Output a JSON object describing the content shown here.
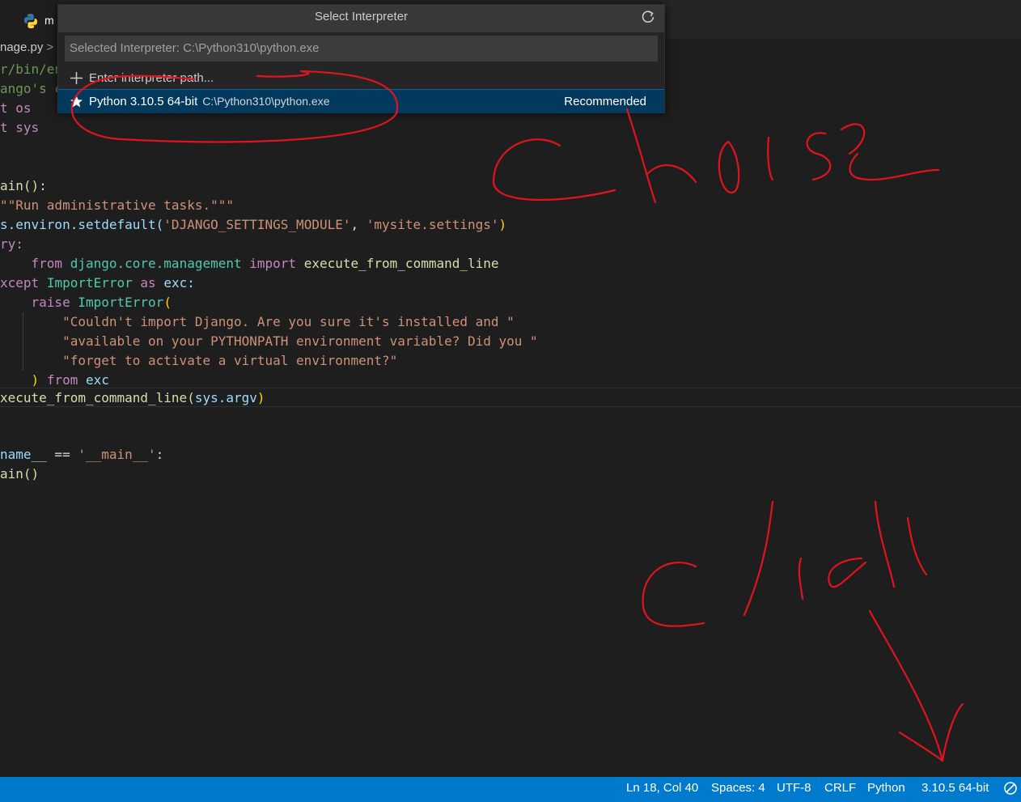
{
  "tab": {
    "label": "m"
  },
  "breadcrumb": {
    "file": "nage.py",
    "separator": ">"
  },
  "code_lines": [
    "r/bin/en",
    "ango's c",
    "t os",
    "t sys"
  ],
  "quick_pick": {
    "title": "Select Interpreter",
    "input_placeholder": "Selected Interpreter: C:\\Python310\\python.exe",
    "items": [
      {
        "label": "Enter interpreter path...",
        "description": "",
        "badge": "",
        "icon": "plus-icon"
      },
      {
        "label": "Python 3.10.5 64-bit",
        "description": "C:\\Python310\\python.exe",
        "badge": "Recommended",
        "icon": "star-icon"
      }
    ]
  },
  "editor": {
    "code": {
      "main_def": "ain():",
      "docstring": "\"\"Run administrative tasks.\"\"\"",
      "environ": "s.environ.setdefault(",
      "settings_key": "'DJANGO_SETTINGS_MODULE'",
      "comma": ", ",
      "settings_val": "'mysite.settings'",
      "try": "ry:",
      "from": "from",
      "module": "django.core.management",
      "import": "import",
      "exec_name": "execute_from_command_line",
      "except": "xcept",
      "import_error": "ImportError",
      "as": "as",
      "exc": "exc:",
      "raise": "raise",
      "err_str1": "\"Couldn't import Django. Are you sure it's installed and \"",
      "err_str2": "\"available on your PYTHONPATH environment variable? Did you \"",
      "err_str3": "\"forget to activate a virtual environment?\"",
      "from_exc": "from",
      "exc_name": "exc",
      "exec_call": "xecute_from_command_line(",
      "argv": "sys.argv",
      "name": "name__",
      "eq": " == ",
      "main_str": "'__main__'",
      "colon": ":",
      "main_call": "ain()"
    }
  },
  "annotations": {
    "choose": "Choose",
    "click": "click",
    "color": "#e0141e"
  },
  "status_bar": {
    "position": "Ln 18, Col 40",
    "spaces": "Spaces: 4",
    "encoding": "UTF-8",
    "eol": "CRLF",
    "language": "Python",
    "interpreter": "3.10.5 64-bit",
    "background": "#007acc"
  }
}
